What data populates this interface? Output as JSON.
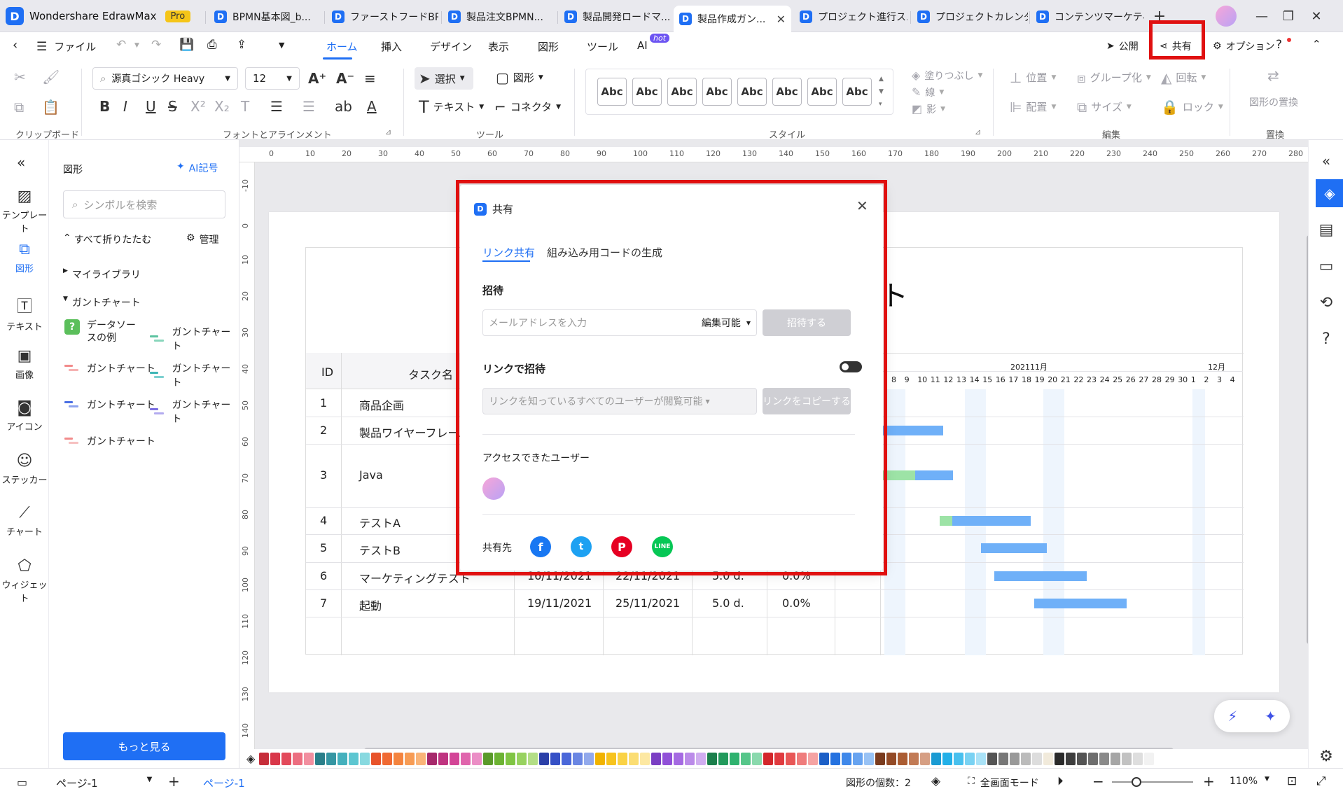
{
  "app": {
    "name": "Wondershare EdrawMax",
    "badge": "Pro"
  },
  "tabs": [
    {
      "label": "BPMN基本図_b..."
    },
    {
      "label": "ファーストフードBP..."
    },
    {
      "label": "製品注文BPMN..."
    },
    {
      "label": "製品開発ロードマ..."
    },
    {
      "label": "製品作成ガン...",
      "active": true
    },
    {
      "label": "プロジェクト進行ス..."
    },
    {
      "label": "プロジェクトカレンダー"
    },
    {
      "label": "コンテンツマーケティ..."
    }
  ],
  "menubar": {
    "file": "ファイル",
    "items": [
      "ホーム",
      "挿入",
      "デザイン",
      "表示",
      "図形",
      "ツール",
      "AI"
    ],
    "ai_badge": "hot",
    "publish": "公開",
    "share": "共有",
    "options": "オプション"
  },
  "ribbon": {
    "font_name": "源真ゴシック Heavy",
    "font_size": "12",
    "select": "選択",
    "shape": "図形",
    "text": "テキスト",
    "connector": "コネクタ",
    "style_sample": "Abc",
    "fill": "塗りつぶし",
    "line": "線",
    "shadow": "影",
    "position": "位置",
    "group": "グループ化",
    "rotate": "回転",
    "align": "配置",
    "size": "サイズ",
    "lock": "ロック",
    "replace_shape": "図形の置換",
    "groups": [
      "クリップボード",
      "フォントとアラインメント",
      "ツール",
      "スタイル",
      "編集",
      "置換"
    ]
  },
  "leftrail": [
    "テンプレート",
    "図形",
    "テキスト",
    "画像",
    "アイコン",
    "ステッカー",
    "チャート",
    "ウィジェット"
  ],
  "shapes_panel": {
    "title": "図形",
    "ai_symbol": "AI記号",
    "search_placeholder": "シンボルを検索",
    "collapse_all": "すべて折りたたむ",
    "manage": "管理",
    "my_library": "マイライブラリ",
    "gantt_section": "ガントチャート",
    "items": [
      "データソースの例",
      "ガントチャート",
      "ガントチャート",
      "ガントチャート",
      "ガントチャート",
      "ガントチャート",
      "ガントチャート"
    ],
    "more": "もっと見る"
  },
  "ruler": {
    "h": [
      "0",
      "10",
      "20",
      "30",
      "40",
      "50",
      "60",
      "70",
      "80",
      "90",
      "100",
      "110",
      "120",
      "130",
      "140",
      "150",
      "160",
      "170",
      "180",
      "190",
      "200",
      "210",
      "220",
      "230",
      "240",
      "250",
      "260",
      "270",
      "280"
    ],
    "v": [
      "-10",
      "0",
      "10",
      "20",
      "30",
      "40",
      "50",
      "60",
      "70",
      "80",
      "90",
      "100",
      "110",
      "120",
      "130",
      "140"
    ]
  },
  "gantt": {
    "title_fragment": "ト",
    "col_id": "ID",
    "col_task": "タスク名",
    "month1": "202111月",
    "month2": "12月",
    "days": [
      "8",
      "9",
      "10",
      "11",
      "12",
      "13",
      "14",
      "15",
      "16",
      "17",
      "18",
      "19",
      "20",
      "21",
      "22",
      "23",
      "24",
      "25",
      "26",
      "27",
      "28",
      "29",
      "30",
      "1",
      "2",
      "3",
      "4"
    ],
    "rows": [
      {
        "id": "1",
        "task": "商品企画",
        "start": "",
        "end": "",
        "dur": "",
        "pct": ""
      },
      {
        "id": "2",
        "task": "製品ワイヤーフレーム",
        "start": "",
        "end": "",
        "dur": "",
        "pct": ""
      },
      {
        "id": "3",
        "task": "Java",
        "start": "",
        "end": "",
        "dur": "",
        "pct": ""
      },
      {
        "id": "4",
        "task": "テストA",
        "start": "",
        "end": "",
        "dur": "",
        "pct": ""
      },
      {
        "id": "5",
        "task": "テストB",
        "start": "",
        "end": "",
        "dur": "",
        "pct": ""
      },
      {
        "id": "6",
        "task": "マーケティングテスト",
        "start": "16/11/2021",
        "end": "22/11/2021",
        "dur": "5.0 d.",
        "pct": "0.0%"
      },
      {
        "id": "7",
        "task": "起動",
        "start": "19/11/2021",
        "end": "25/11/2021",
        "dur": "5.0 d.",
        "pct": "0.0%"
      }
    ]
  },
  "dialog": {
    "title": "共有",
    "tab_link": "リンク共有",
    "tab_embed": "組み込み用コードの生成",
    "invite_heading": "招待",
    "email_placeholder": "メールアドレスを入力",
    "permission": "編集可能",
    "invite_button": "招待する",
    "link_invite": "リンクで招待",
    "link_access": "リンクを知っているすべてのユーザーが閲覧可能",
    "copy_link": "リンクをコピーする",
    "access_users": "アクセスできたユーザー",
    "share_to": "共有先"
  },
  "statusbar": {
    "page_selector": "ページ-1",
    "page_tab": "ページ-1",
    "shape_count": "図形の個数：2",
    "fullscreen": "全画面モード",
    "zoom": "110%"
  },
  "colors": {
    "accent": "#1f6ff4",
    "highlight": "#e01010",
    "gantt_bar": "#6fb0f8",
    "gantt_bar_done": "#9de3a6",
    "palette": [
      "#c62d3a",
      "#d9374a",
      "#e34a5b",
      "#ec6e80",
      "#f28fa0",
      "#2a7f8a",
      "#3596a3",
      "#44b0bd",
      "#5dc6d1",
      "#88d9e0",
      "#e8532b",
      "#f06a34",
      "#f4843f",
      "#f79c55",
      "#fab478",
      "#a6286b",
      "#bf3380",
      "#d34597",
      "#e065ad",
      "#eb8ec6",
      "#5a9a2a",
      "#6cb333",
      "#80c544",
      "#98d260",
      "#b3de86",
      "#2b3fa8",
      "#3550c6",
      "#4a67d9",
      "#6a86e3",
      "#92a9ec",
      "#f1b300",
      "#f7c31d",
      "#fad245",
      "#fbdd73",
      "#fde8a2",
      "#7b3fc4",
      "#9150d8",
      "#a56ae2",
      "#bb8be9",
      "#d0adf0",
      "#1b7f4c",
      "#229a5c",
      "#2fb26f",
      "#56c68a",
      "#8ad9ad",
      "#d3262b",
      "#e03a3f",
      "#e85757",
      "#ef7c7c",
      "#f5a3a3",
      "#1c5fc7",
      "#2572e0",
      "#3f88ea",
      "#67a3f0",
      "#98c2f5",
      "#7a3b1e",
      "#934a26",
      "#ab5d33",
      "#c27b56",
      "#d69f84",
      "#1a9bd3",
      "#23b0e8",
      "#48c0ee",
      "#79d2f3",
      "#a9e2f7",
      "#555",
      "#777",
      "#999",
      "#bbb",
      "#ddd",
      "#f1eadb",
      "#2a2a2a",
      "#3d3d3d",
      "#545454",
      "#6e6e6e",
      "#8a8a8a",
      "#a6a6a6",
      "#c2c2c2",
      "#dedede",
      "#f2f2f2"
    ]
  }
}
